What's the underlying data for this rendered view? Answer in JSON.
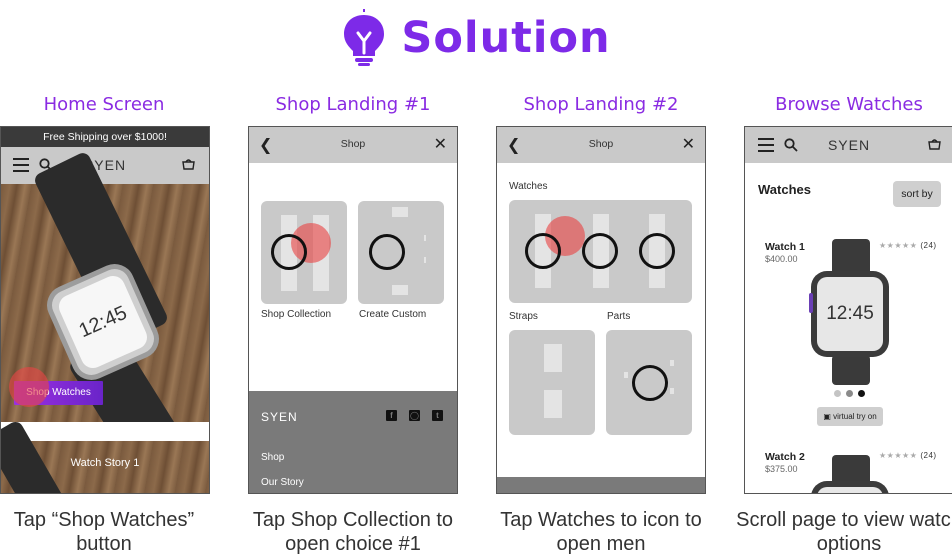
{
  "header": {
    "title": "Solution",
    "icon": "lightbulb-icon",
    "accent": "#7d2ae8"
  },
  "columns": [
    {
      "title": "Home Screen",
      "caption": "Tap “Shop Watches” button"
    },
    {
      "title": "Shop Landing #1",
      "caption": "Tap Shop Collection to open choice #1"
    },
    {
      "title": "Shop Landing #2",
      "caption": "Tap Watches to icon to open men"
    },
    {
      "title": "Browse Watches",
      "caption": "Scroll page to view watch options"
    }
  ],
  "home": {
    "banner": "Free Shipping over $1000!",
    "brand": "SYEN",
    "watch_time": "12:45",
    "cta": "Shop Watches",
    "story": "Watch Story 1"
  },
  "shop1": {
    "title": "Shop",
    "tiles": [
      "Shop Collection",
      "Create Custom"
    ],
    "footer": {
      "brand": "SYEN",
      "links": [
        "Shop",
        "Our Story"
      ]
    }
  },
  "shop2": {
    "title": "Shop",
    "section_watches": "Watches",
    "section_straps": "Straps",
    "section_parts": "Parts"
  },
  "browse": {
    "brand": "SYEN",
    "title": "Watches",
    "sort": "sort by",
    "items": [
      {
        "name": "Watch 1",
        "price": "$400.00",
        "stars": "★★★★★",
        "reviews": "(24)",
        "time": "12:45"
      },
      {
        "name": "Watch 2",
        "price": "$375.00",
        "stars": "★★★★★",
        "reviews": "(24)"
      }
    ],
    "try_on": "virtual try on",
    "carousel_active": 3
  }
}
